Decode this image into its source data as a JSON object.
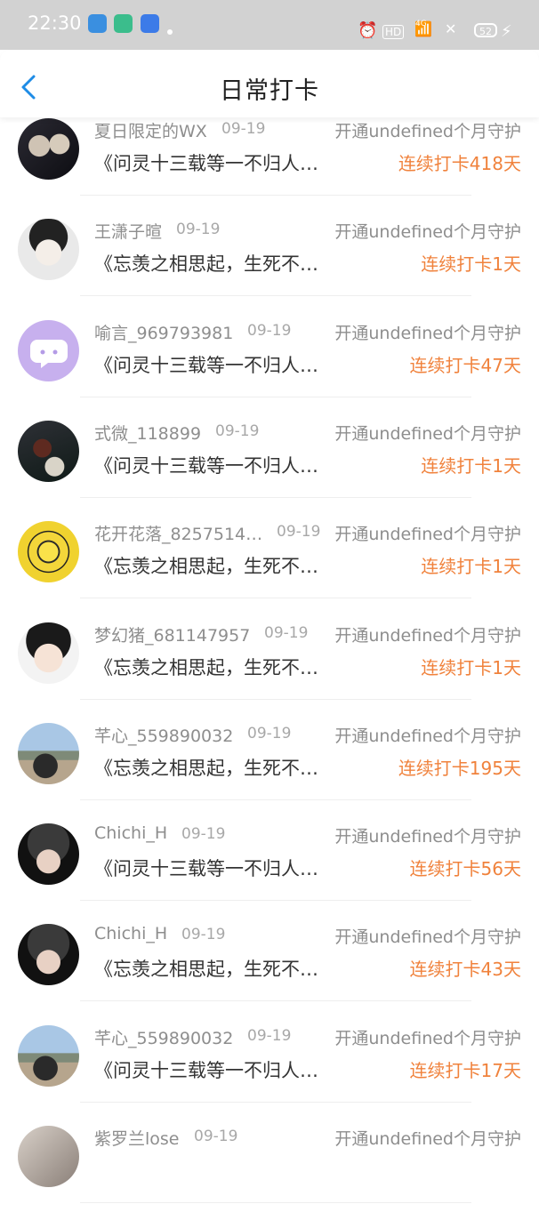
{
  "status": {
    "time": "22:30",
    "battery": "52",
    "hd": "HD",
    "network": "4G"
  },
  "header": {
    "title": "日常打卡"
  },
  "rows": [
    {
      "name": "夏日限定的WX",
      "date": "09-19",
      "guard": "开通undefined个月守护",
      "book": "《问灵十三载等一不归人…",
      "streak": "连续打卡418天",
      "avatar": "couple-photo"
    },
    {
      "name": "王潇子暄",
      "date": "09-19",
      "guard": "开通undefined个月守护",
      "book": "《忘羡之相思起，生死不…",
      "streak": "连续打卡1天",
      "avatar": "anime-girl"
    },
    {
      "name": "喻言_969793981",
      "date": "09-19",
      "guard": "开通undefined个月守护",
      "book": "《问灵十三载等一不归人…",
      "streak": "连续打卡47天",
      "avatar": "purple-chat-bubble"
    },
    {
      "name": "式微_118899",
      "date": "09-19",
      "guard": "开通undefined个月守护",
      "book": "《问灵十三载等一不归人…",
      "streak": "连续打卡1天",
      "avatar": "teapot-scene"
    },
    {
      "name": "花开花落_8257514…",
      "date": "09-19",
      "guard": "开通undefined个月守护",
      "book": "《忘羡之相思起，生死不…",
      "streak": "连续打卡1天",
      "avatar": "yellow-compass"
    },
    {
      "name": "梦幻猪_681147957",
      "date": "09-19",
      "guard": "开通undefined个月守护",
      "book": "《忘羡之相思起，生死不…",
      "streak": "连续打卡1天",
      "avatar": "cartoon-girl"
    },
    {
      "name": "芊心_559890032",
      "date": "09-19",
      "guard": "开通undefined个月守护",
      "book": "《忘羡之相思起，生死不…",
      "streak": "连续打卡195天",
      "avatar": "woman-by-sea"
    },
    {
      "name": "Chichi_H",
      "date": "09-19",
      "guard": "开通undefined个月守护",
      "book": "《问灵十三载等一不归人…",
      "streak": "连续打卡56天",
      "avatar": "girl-in-hat"
    },
    {
      "name": "Chichi_H",
      "date": "09-19",
      "guard": "开通undefined个月守护",
      "book": "《忘羡之相思起，生死不…",
      "streak": "连续打卡43天",
      "avatar": "girl-in-hat"
    },
    {
      "name": "芊心_559890032",
      "date": "09-19",
      "guard": "开通undefined个月守护",
      "book": "《问灵十三载等一不归人…",
      "streak": "连续打卡17天",
      "avatar": "woman-by-sea"
    },
    {
      "name": "紫罗兰lose",
      "date": "09-19",
      "guard": "开通undefined个月守护",
      "book": "",
      "streak": "",
      "avatar": "partial"
    }
  ],
  "colors": {
    "accent": "#1e8ce6",
    "streak": "#f0823c",
    "status_bar": "#d2d2d2"
  }
}
